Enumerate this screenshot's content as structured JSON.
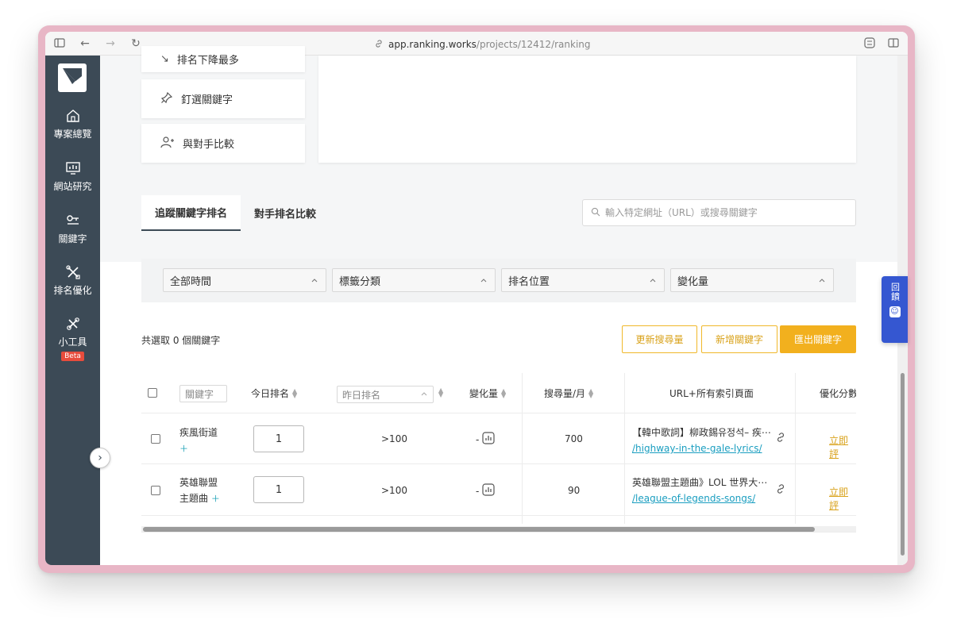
{
  "browser": {
    "url_host": "app.ranking.works",
    "url_path": "/projects/12412/ranking"
  },
  "sidebar": {
    "items": [
      {
        "label": "專案總覽",
        "icon": "home-icon"
      },
      {
        "label": "網站研究",
        "icon": "monitor-chart-icon"
      },
      {
        "label": "關鍵字",
        "icon": "key-icon"
      },
      {
        "label": "排名優化",
        "icon": "tools-cross-icon"
      },
      {
        "label": "小工具",
        "icon": "wrench-icon",
        "badge": "Beta"
      }
    ]
  },
  "actions": {
    "partial_top": "排名下降最多",
    "pin_keywords": "釘選關鍵字",
    "compare_competitor": "與對手比較"
  },
  "tabs": [
    {
      "label": "追蹤關鍵字排名",
      "active": true
    },
    {
      "label": "對手排名比較",
      "active": false
    }
  ],
  "search": {
    "placeholder": "輸入特定網址（URL）或搜尋關鍵字",
    "value": ""
  },
  "filters": [
    {
      "label": "全部時間"
    },
    {
      "label": "標籤分類"
    },
    {
      "label": "排名位置"
    },
    {
      "label": "變化量"
    }
  ],
  "selection": {
    "text": "共選取 0 個關鍵字"
  },
  "buttons": {
    "update_volume": "更新搜尋量",
    "add_keyword": "新增關鍵字",
    "export_keyword": "匯出關鍵字"
  },
  "table": {
    "headers": {
      "keyword_placeholder": "關鍵字",
      "today_rank": "今日排名",
      "yesterday_placeholder": "昨日排名",
      "change": "變化量",
      "volume": "搜尋量/月",
      "url": "URL+所有索引頁面",
      "score": "優化分數"
    },
    "rows": [
      {
        "keyword": "疾風街道",
        "keyword_line2": "",
        "today_rank": "1",
        "yesterday_rank": ">100",
        "change": "-",
        "volume": "700",
        "url_title": "【韓中歌詞】柳政錫유정석– 疾⋯",
        "url_link": "/highway-in-the-gale-lyrics/",
        "score": "立即評"
      },
      {
        "keyword": "英雄聯盟",
        "keyword_line2": "主題曲",
        "today_rank": "1",
        "yesterday_rank": ">100",
        "change": "-",
        "volume": "90",
        "url_title": "英雄聯盟主題曲》LOL 世界大⋯",
        "url_link": "/league-of-legends-songs/",
        "score": "立即評"
      }
    ]
  },
  "widget": {
    "text": "回饋"
  }
}
